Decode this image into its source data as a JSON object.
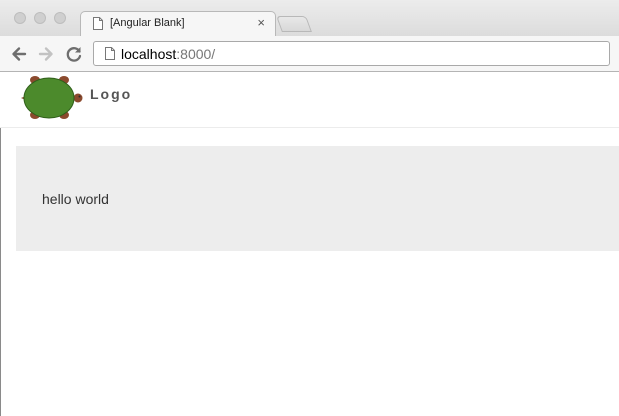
{
  "browser": {
    "tab_title": "[Angular Blank]",
    "tab_close": "×",
    "address_host": "localhost",
    "address_path": ":8000/",
    "icons": {
      "back": "arrow-left-icon",
      "forward": "arrow-right-icon",
      "reload": "reload-icon",
      "page": "page-icon"
    }
  },
  "header": {
    "logo_text": "Logo"
  },
  "main": {
    "message": "hello world"
  },
  "colors": {
    "turtle_shell": "#4c8a2c",
    "turtle_limbs": "#8b4a2e",
    "content_bg": "#ededed"
  }
}
